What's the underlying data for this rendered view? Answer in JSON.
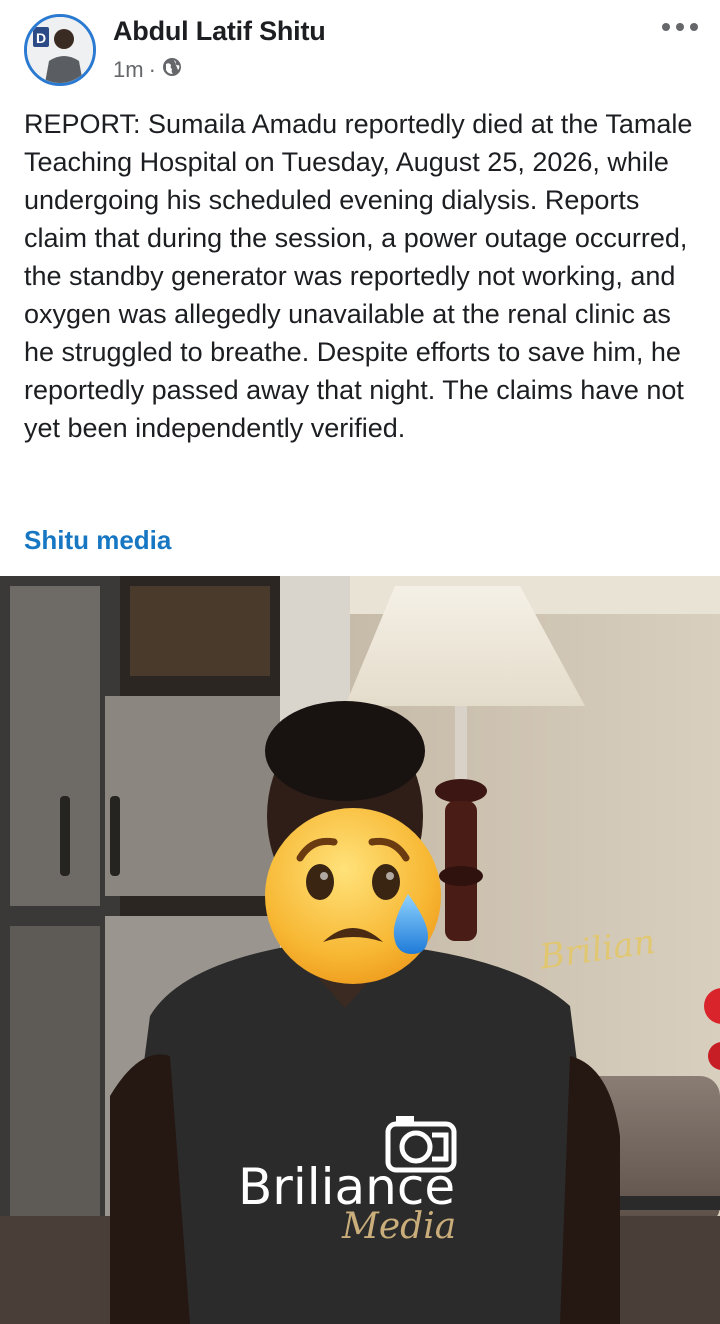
{
  "post": {
    "author_name": "Abdul Latif Shitu",
    "timestamp": "1m",
    "separator": "·",
    "privacy_icon": "globe-icon",
    "more_icon": "more-horizontal-icon",
    "avatar_badge_text": "D",
    "body_text": "REPORT: Sumaila Amadu reportedly died at the Tamale Teaching Hospital on Tuesday, August 25, 2026, while undergoing his scheduled evening dialysis. Reports claim that during the session, a power outage occurred, the standby generator was reportedly not working, and oxygen was allegedly unavailable at the renal clinic as he struggled to breathe. Despite efforts to save him, he reportedly passed away that night. The claims have not yet been independently verified.",
    "page_link": "Shitu media"
  },
  "photo": {
    "shirt_brand_line1": "Briliance",
    "shirt_brand_line2": "Media",
    "watermark": "Brilian",
    "face_cover": "sad-tear-emoji"
  },
  "colors": {
    "link": "#1877c2",
    "avatar_ring": "#2a7ad1",
    "text": "#1c1e21",
    "meta": "#65676b"
  }
}
